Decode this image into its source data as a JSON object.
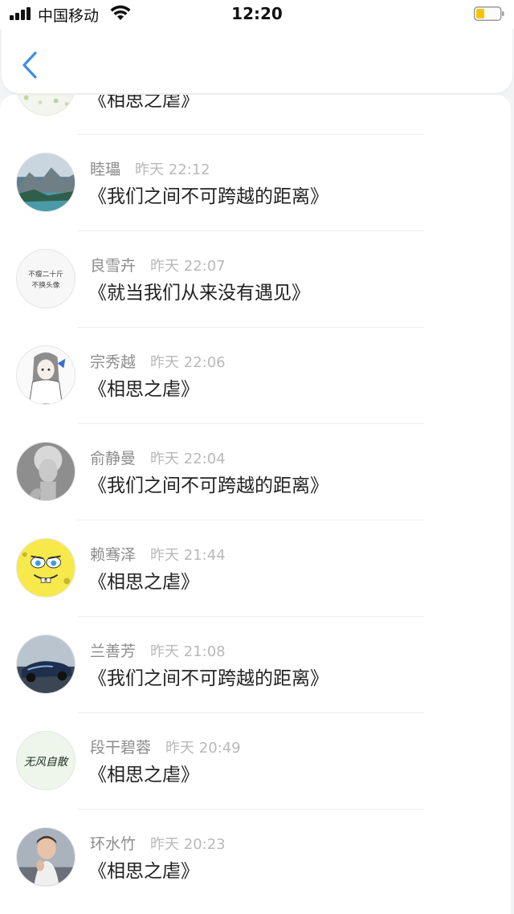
{
  "status_bar": {
    "carrier": "中国移动",
    "time": "12:20"
  },
  "nav": {
    "back_icon": "chevron-left-icon",
    "accent_color": "#3d8fe0"
  },
  "comments": [
    {
      "name": "",
      "time": "",
      "text": "《相思之虐》"
    },
    {
      "name": "睦瓃",
      "time": "昨天 22:12",
      "text": "《我们之间不可跨越的距离》"
    },
    {
      "name": "良雪卉",
      "time": "昨天 22:07",
      "text": "《就当我们从来没有遇见》"
    },
    {
      "name": "宗秀越",
      "time": "昨天 22:06",
      "text": "《相思之虐》"
    },
    {
      "name": "俞静曼",
      "time": "昨天 22:04",
      "text": "《我们之间不可跨越的距离》"
    },
    {
      "name": "赖骞泽",
      "time": "昨天 21:44",
      "text": "《相思之虐》"
    },
    {
      "name": "兰善芳",
      "time": "昨天 21:08",
      "text": "《我们之间不可跨越的距离》"
    },
    {
      "name": "段干碧蓉",
      "time": "昨天 20:49",
      "text": "《相思之虐》"
    },
    {
      "name": "环水竹",
      "time": "昨天 20:23",
      "text": "《相思之虐》"
    }
  ],
  "avatar_text": {
    "liang": [
      "不瘦二十斤",
      "不换头像"
    ],
    "duangan": "无风自散"
  }
}
